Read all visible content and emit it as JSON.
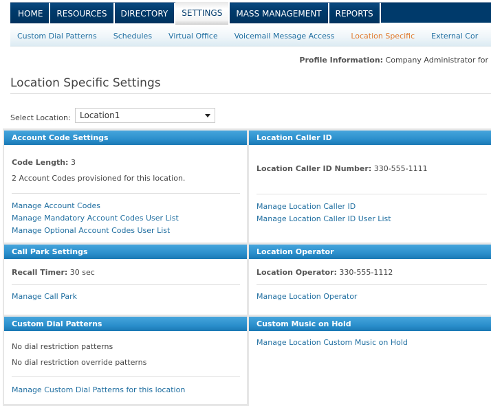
{
  "topnav": {
    "tabs": [
      {
        "label": "HOME",
        "active": false
      },
      {
        "label": "RESOURCES",
        "active": false
      },
      {
        "label": "DIRECTORY",
        "active": false
      },
      {
        "label": "SETTINGS",
        "active": true
      },
      {
        "label": "MASS MANAGEMENT",
        "active": false
      },
      {
        "label": "REPORTS",
        "active": false
      }
    ]
  },
  "subnav": {
    "items": [
      {
        "label": "Custom Dial Patterns",
        "active": false
      },
      {
        "label": "Schedules",
        "active": false
      },
      {
        "label": "Virtual Office",
        "active": false
      },
      {
        "label": "Voicemail Message Access",
        "active": false
      },
      {
        "label": "Location Specific",
        "active": true
      },
      {
        "label": "External Cor",
        "active": false
      }
    ]
  },
  "profile": {
    "label": "Profile Information:",
    "value": " Company Administrator for"
  },
  "page": {
    "title": "Location Specific Settings"
  },
  "location_select": {
    "label": "Select Location:",
    "value": "Location1"
  },
  "panels": {
    "account_codes": {
      "title": "Account Code Settings",
      "code_length_label": "Code Length:",
      "code_length_value": " 3",
      "provisioned_text": "2 Account Codes provisioned for this location.",
      "links": [
        "Manage Account Codes",
        "Manage Mandatory Account Codes User List",
        "Manage Optional Account Codes User List"
      ]
    },
    "caller_id": {
      "title": "Location Caller ID",
      "number_label": "Location Caller ID Number:",
      "number_value": "  330-555-1111",
      "links": [
        "Manage Location Caller ID",
        "Manage Location Caller ID User List"
      ]
    },
    "call_park": {
      "title": "Call Park Settings",
      "recall_label": "Recall Timer:",
      "recall_value": " 30 sec",
      "links": [
        "Manage Call Park"
      ]
    },
    "operator": {
      "title": "Location Operator",
      "operator_label": "Location Operator:",
      "operator_value": "  330-555-1112",
      "links": [
        "Manage Location Operator"
      ]
    },
    "dial_patterns": {
      "title": "Custom Dial Patterns",
      "lines": [
        "No dial restriction patterns",
        "No dial restriction override patterns"
      ],
      "links": [
        "Manage Custom Dial Patterns for this location"
      ]
    },
    "music_on_hold": {
      "title": "Custom Music on Hold",
      "links": [
        "Manage Location Custom Music on Hold"
      ]
    }
  },
  "colors": {
    "nav_bg": "#003a6b",
    "panel_header": "#2b8fcc",
    "link": "#1f6ea0",
    "active_subnav": "#e07a2e"
  }
}
